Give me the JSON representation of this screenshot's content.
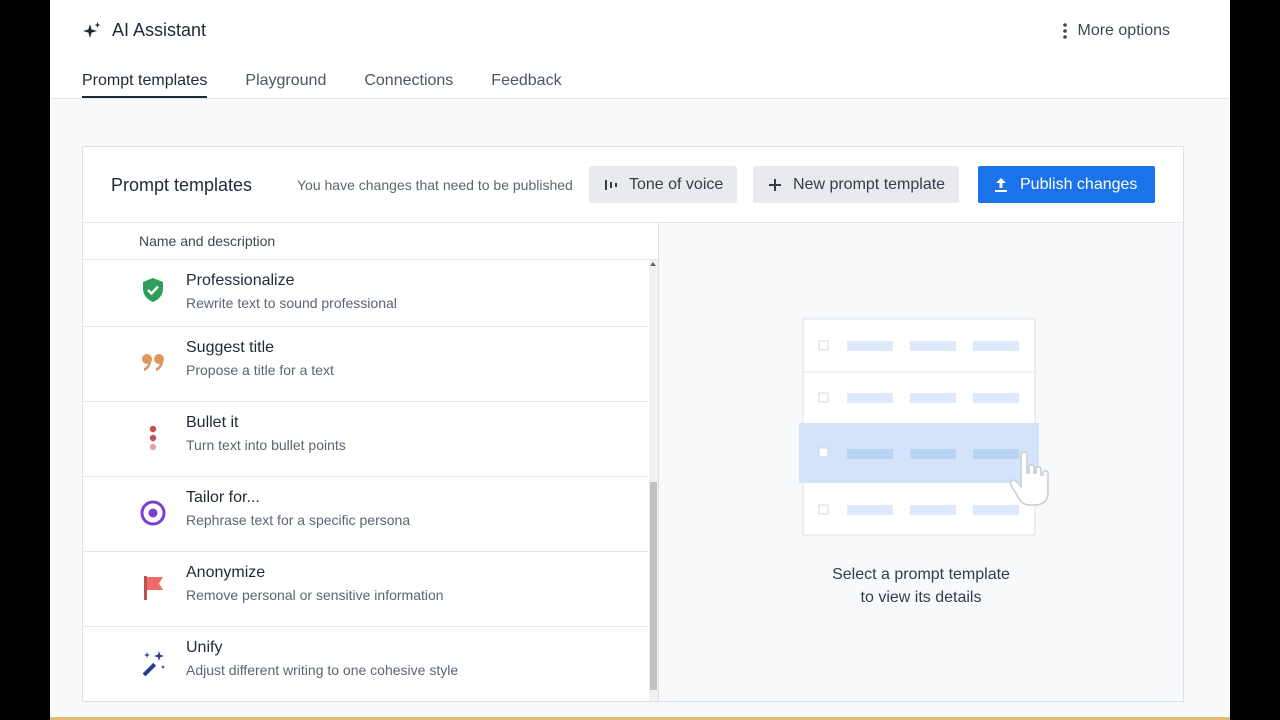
{
  "header": {
    "app_title": "AI Assistant",
    "more_options": "More options",
    "tabs": [
      {
        "label": "Prompt templates",
        "active": true
      },
      {
        "label": "Playground",
        "active": false
      },
      {
        "label": "Connections",
        "active": false
      },
      {
        "label": "Feedback",
        "active": false
      }
    ]
  },
  "panel": {
    "title": "Prompt templates",
    "notice": "You have changes that need to be published",
    "buttons": {
      "tone": "Tone of voice",
      "new_template": "New prompt template",
      "publish": "Publish changes"
    },
    "column_header": "Name and description",
    "templates": [
      {
        "name": "Professionalize",
        "description": "Rewrite text to sound professional",
        "icon": "shield-check-icon",
        "color": "#2e9e5b"
      },
      {
        "name": "Suggest title",
        "description": "Propose a title for a text",
        "icon": "quote-icon",
        "color": "#e0965a"
      },
      {
        "name": "Bullet it",
        "description": "Turn text into bullet points",
        "icon": "bullets-icon",
        "color": "#c0504d"
      },
      {
        "name": "Tailor for...",
        "description": "Rephrase text for a specific persona",
        "icon": "target-icon",
        "color": "#7b3fd1"
      },
      {
        "name": "Anonymize",
        "description": "Remove personal or sensitive information",
        "icon": "flag-icon",
        "color": "#d9534f"
      },
      {
        "name": "Unify",
        "description": "Adjust different writing to one cohesive style",
        "icon": "magic-wand-icon",
        "color": "#2f3a8f"
      }
    ],
    "empty_state": {
      "line1": "Select a prompt template",
      "line2": "to view its details"
    }
  },
  "colors": {
    "accent": "#1a73e8",
    "highlight_row": "#d3e4fa"
  }
}
